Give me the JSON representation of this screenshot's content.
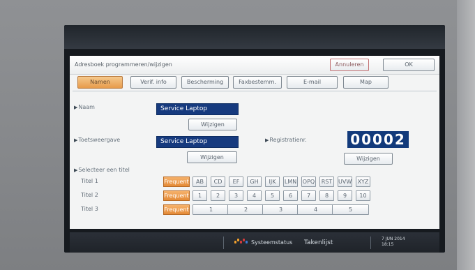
{
  "window": {
    "title": "Adresboek programmeren/wijzigen",
    "cancel_label": "Annuleren",
    "ok_label": "OK"
  },
  "tabs": [
    {
      "label": "Namen",
      "active": true
    },
    {
      "label": "Verif. info",
      "active": false
    },
    {
      "label": "Bescherming",
      "active": false
    },
    {
      "label": "Faxbestemm.",
      "active": false
    },
    {
      "label": "E-mail",
      "active": false
    },
    {
      "label": "Map",
      "active": false
    }
  ],
  "fields": {
    "name_label": "Naam",
    "name_value": "Service Laptop",
    "name_change_label": "Wijzigen",
    "key_label": "Toetsweergave",
    "key_value": "Service Laptop",
    "key_change_label": "Wijzigen",
    "registration_label": "Registratienr.",
    "registration_value": "00002",
    "registration_change_label": "Wijzigen",
    "select_title_label": "Selecteer een titel"
  },
  "title_rows": [
    {
      "label": "Titel 1",
      "frequent_label": "Frequent",
      "options": [
        "AB",
        "CD",
        "EF",
        "GH",
        "IJK",
        "LMN",
        "OPQ",
        "RST",
        "UVW",
        "XYZ"
      ]
    },
    {
      "label": "Titel 2",
      "frequent_label": "Frequent",
      "options": [
        "1",
        "2",
        "3",
        "4",
        "5",
        "6",
        "7",
        "8",
        "9",
        "10"
      ]
    },
    {
      "label": "Titel 3",
      "frequent_label": "Frequent",
      "options": [
        "1",
        "2",
        "3",
        "4",
        "5"
      ]
    }
  ],
  "status": {
    "system_status_label": "Systeemstatus",
    "job_list_label": "Takenlijst",
    "date": "7 JUN 2014",
    "time": "18:15"
  },
  "colors": {
    "accent": "#e79b4b",
    "selection_blue": "#163a7e",
    "screen_bg": "#f3f4f4"
  }
}
